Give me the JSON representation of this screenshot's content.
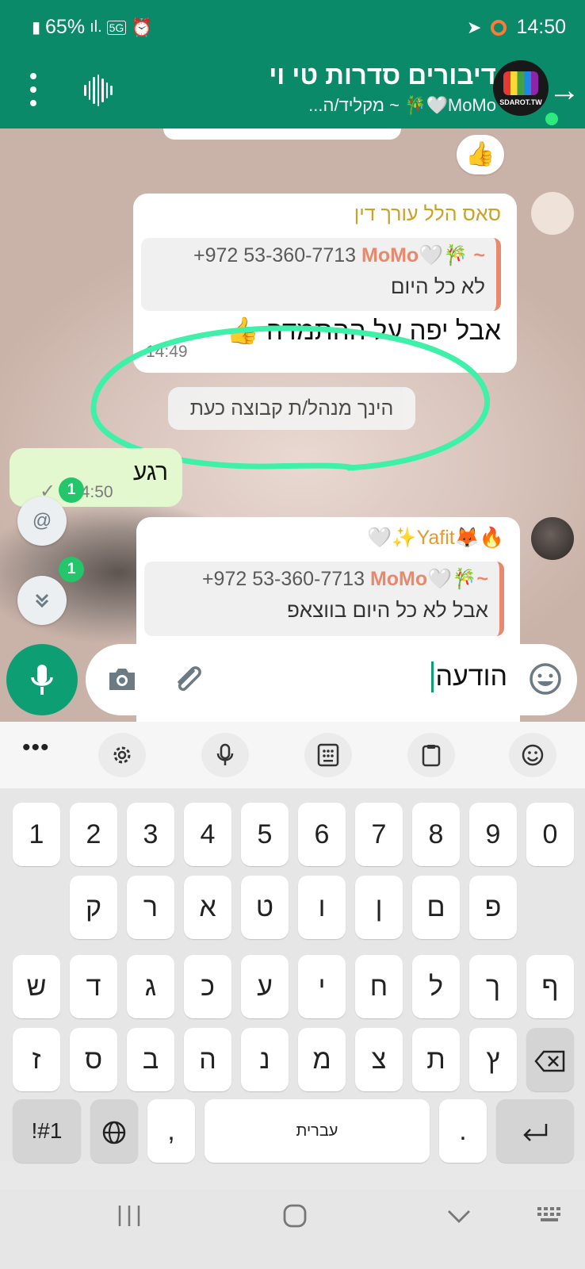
{
  "status_bar": {
    "battery": "65%",
    "network": "5G",
    "time": "14:50"
  },
  "header": {
    "title": "דיבורים סדרות טי וי",
    "subtitle": "MoMo🤍🎋 ~ מקליד/ה...",
    "avatar_label": "SDAROT.TW"
  },
  "messages": {
    "reaction": "👍",
    "msg1": {
      "sender": "סאס הלל עורך דין",
      "quote_name": "MoMo🤍🎋 ~",
      "quote_number": "+972 53-360-7713",
      "quote_text": "לא כל היום",
      "text": "אבל יפה על ההתמדה 👍",
      "time": "14:49"
    },
    "system": "הינך מנהל/ת קבוצה כעת",
    "outgoing": {
      "text": "רגע",
      "time": "14:50"
    },
    "msg2": {
      "sender": "🔥🦊Yafit✨🤍",
      "quote_name": "MoMo🤍🎋~",
      "quote_number": "+972 53-360-7713",
      "quote_text": "אבל לא כל היום בווצאפ"
    }
  },
  "badges": {
    "mentions": "1",
    "unread": "1",
    "at_symbol": "@"
  },
  "composer": {
    "text": "הודעה"
  },
  "keyboard": {
    "row_numbers": [
      "1",
      "2",
      "3",
      "4",
      "5",
      "6",
      "7",
      "8",
      "9",
      "0"
    ],
    "row_1": [
      "ק",
      "ר",
      "א",
      "ט",
      "ו",
      "ן",
      "ם",
      "פ"
    ],
    "row_2": [
      "ש",
      "ד",
      "ג",
      "כ",
      "ע",
      "י",
      "ח",
      "ל",
      "ך",
      "ף"
    ],
    "row_3": [
      "ז",
      "ס",
      "ב",
      "ה",
      "נ",
      "מ",
      "צ",
      "ת",
      "ץ"
    ],
    "symbols_key": "!#1",
    "comma": ",",
    "space_label": "עברית",
    "period": "."
  },
  "colors": {
    "header": "#0b8a6a",
    "accent": "#0e9e74",
    "outgoing_bubble": "#e4f8cf",
    "quote_name": "#e8896d",
    "annotation": "#3ef0a8"
  }
}
